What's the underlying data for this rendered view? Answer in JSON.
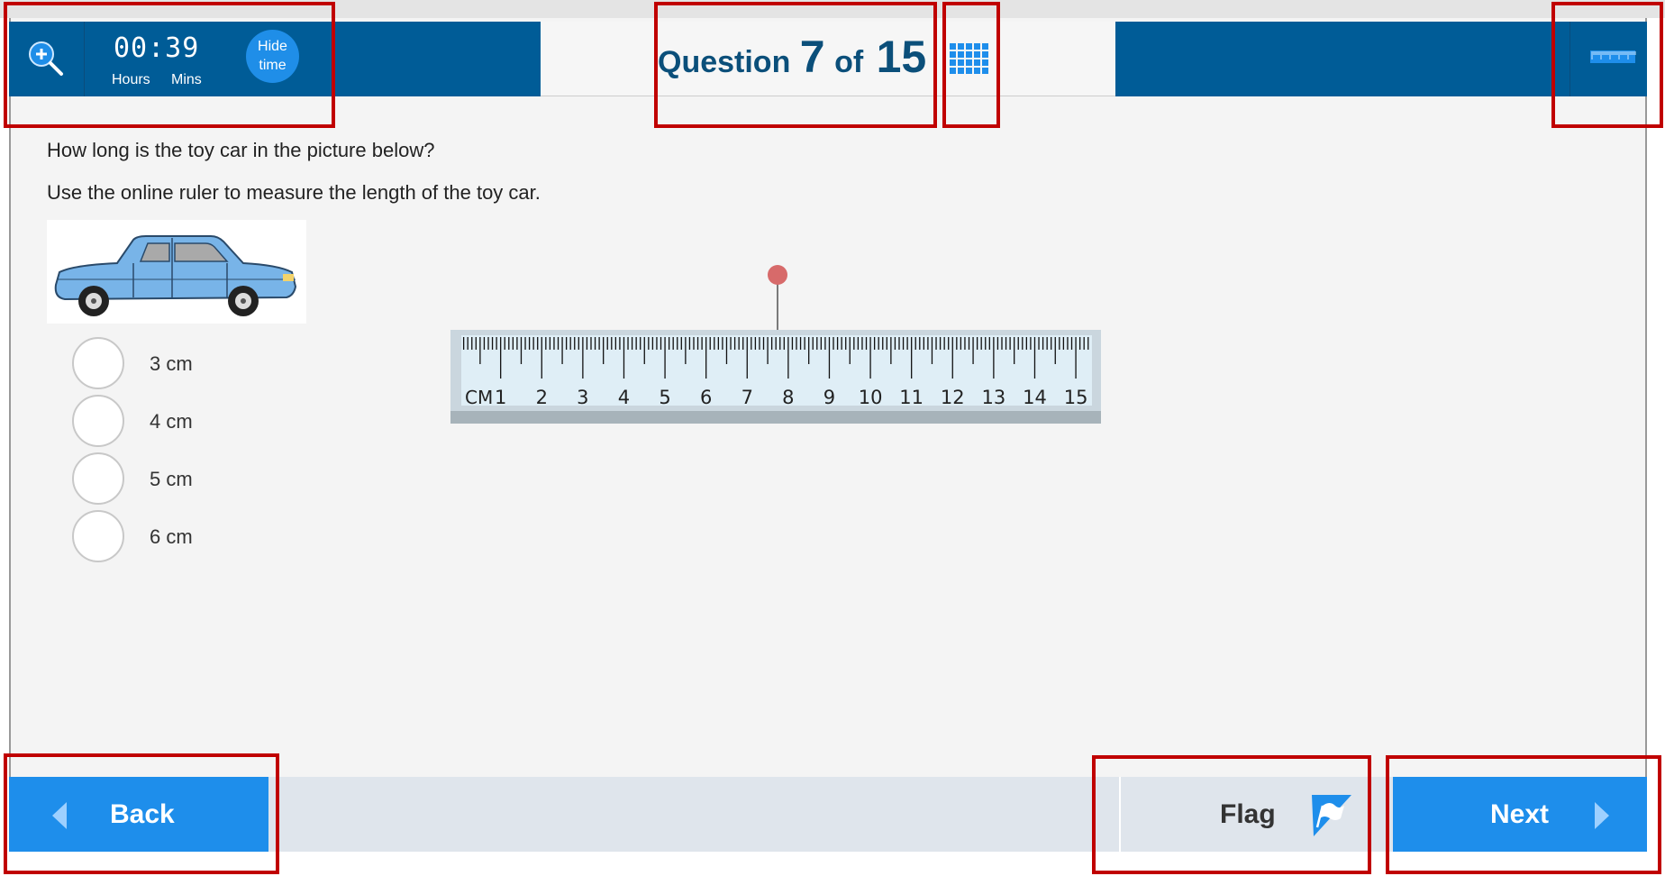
{
  "header": {
    "timer": {
      "digits": "00:39",
      "hours_label": "Hours",
      "mins_label": "Mins"
    },
    "hide_time_line1": "Hide",
    "hide_time_line2": "time",
    "question_word": "Question",
    "question_number": "7",
    "of_word": "of",
    "question_total": "15"
  },
  "question": {
    "prompt": "How long is the toy car in the picture below?",
    "instruction": "Use the online ruler to measure the length of the toy car."
  },
  "options": [
    {
      "label": "3 cm"
    },
    {
      "label": "4 cm"
    },
    {
      "label": "5 cm"
    },
    {
      "label": "6 cm"
    }
  ],
  "ruler": {
    "unit_label": "CM",
    "numbers": [
      "1",
      "2",
      "3",
      "4",
      "5",
      "6",
      "7",
      "8",
      "9",
      "10",
      "11",
      "12",
      "13",
      "14",
      "15"
    ]
  },
  "footer": {
    "back_label": "Back",
    "flag_label": "Flag",
    "next_label": "Next"
  },
  "colors": {
    "header_blue": "#005c97",
    "button_blue": "#1e8eeb",
    "highlight_red": "#c00000",
    "car_blue": "#78b4e8"
  }
}
